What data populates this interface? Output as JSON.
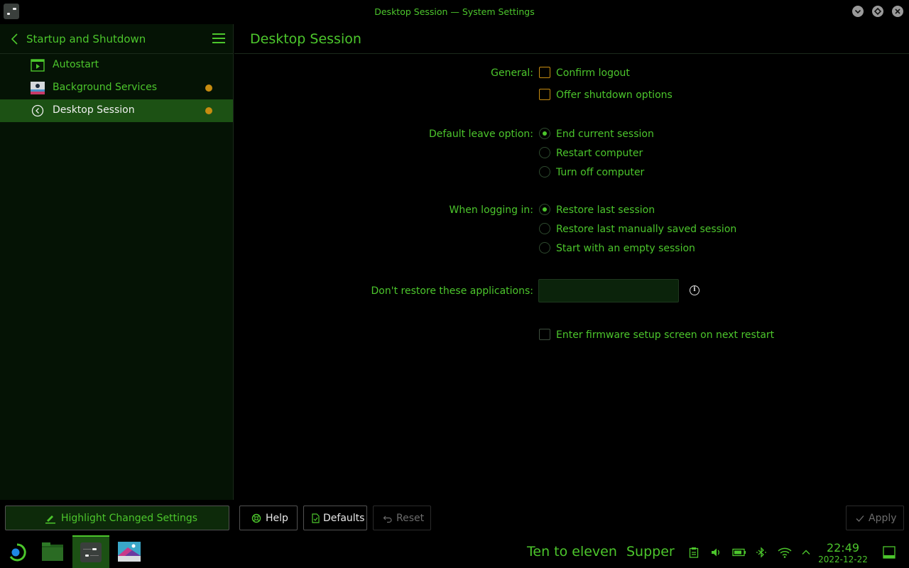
{
  "window": {
    "title": "Desktop Session — System Settings"
  },
  "sidebar": {
    "back_title": "Startup and Shutdown",
    "items": [
      {
        "label": "Autostart",
        "icon": "autostart-icon",
        "changed": false
      },
      {
        "label": "Background Services",
        "icon": "background-services-icon",
        "changed": true
      },
      {
        "label": "Desktop Session",
        "icon": "desktop-session-icon",
        "changed": true,
        "active": true
      }
    ],
    "highlight_button": "Highlight Changed Settings"
  },
  "main": {
    "title": "Desktop Session",
    "general": {
      "label": "General:",
      "confirm_logout": {
        "label": "Confirm logout",
        "checked": false
      },
      "offer_shutdown": {
        "label": "Offer shutdown options",
        "checked": false
      }
    },
    "leave_option": {
      "label": "Default leave option:",
      "options": [
        "End current session",
        "Restart computer",
        "Turn off computer"
      ],
      "selected": "End current session"
    },
    "logging_in": {
      "label": "When logging in:",
      "options": [
        "Restore last session",
        "Restore last manually saved session",
        "Start with an empty session"
      ],
      "selected": "Restore last session"
    },
    "dont_restore": {
      "label": "Don't restore these applications:",
      "value": ""
    },
    "firmware": {
      "label": "Enter firmware setup screen on next restart",
      "checked": false
    }
  },
  "buttons": {
    "help": "Help",
    "defaults": "Defaults",
    "reset": "Reset",
    "apply": "Apply"
  },
  "taskbar": {
    "media_title": "Ten to eleven",
    "media_artist": "Supper",
    "time": "22:49",
    "date": "2022-12-22"
  },
  "colors": {
    "accent": "#4cc62c",
    "selection": "#1c5114",
    "changed_dot": "#c78c10",
    "background": "#000000"
  }
}
